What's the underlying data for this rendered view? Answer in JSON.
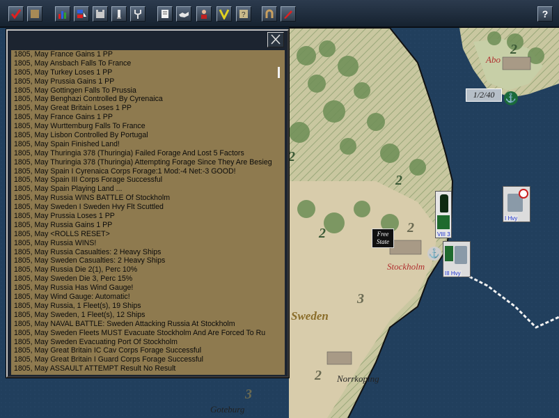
{
  "toolbar": {
    "buttons": [
      {
        "name": "checkmark-tool-button",
        "icon": "red-checkmark-icon"
      },
      {
        "name": "blank-tool-button",
        "icon": "tan-square-icon"
      },
      {
        "name": "bar-chart-button",
        "icon": "bar-chart-icon"
      },
      {
        "name": "unit-list-button",
        "icon": "flag-list-icon"
      },
      {
        "name": "fortress-button",
        "icon": "fortress-icon"
      },
      {
        "name": "lighthouse-button",
        "icon": "tower-icon"
      },
      {
        "name": "fork-button",
        "icon": "fork-icon"
      },
      {
        "name": "document-button",
        "icon": "document-icon"
      },
      {
        "name": "handshake-button",
        "icon": "handshake-icon"
      },
      {
        "name": "leader-button",
        "icon": "leader-portrait-icon"
      },
      {
        "name": "victory-button",
        "icon": "victory-v-icon"
      },
      {
        "name": "question-scroll-button",
        "icon": "question-scroll-icon"
      },
      {
        "name": "horseshoe-button",
        "icon": "horseshoe-icon"
      },
      {
        "name": "pen-button",
        "icon": "red-pen-icon"
      }
    ],
    "help_label": "?"
  },
  "log": {
    "close_label": "✕",
    "selected_index": 37,
    "entries": [
      "1805, May France Gains 1 PP",
      "1805, May Ansbach Falls To France",
      "1805, May Turkey Loses 1 PP",
      "1805, May Prussia Gains 1 PP",
      "1805, May Gottingen Falls To Prussia",
      "1805, May Benghazi Controlled By Cyrenaica",
      "1805, May Great Britain Loses 1 PP",
      "1805, May France Gains 1 PP",
      "1805, May Wurttemburg Falls To France",
      "1805, May Lisbon Controlled By Portugal",
      "1805, May Spain Finished Land!",
      "1805, May Thuringia 378 (Thuringia) Failed Forage And Lost 5 Factors",
      "1805, May Thuringia 378 (Thuringia) Attempting Forage Since They Are Besieg",
      "1805, May Spain I Cyrenaica Corps Forage:1 Mod:-4 Net:-3 GOOD!",
      "1805, May Spain III Corps Forage Successful",
      "1805, May Spain Playing Land ...",
      "1805, May Russia WINS BATTLE Of Stockholm",
      "1805, May Sweden I Sweden Hvy Flt Scuttled",
      "1805, May Prussia Loses 1 PP",
      "1805, May Russia Gains 1 PP",
      "1805, May <ROLLS RESET>",
      "1805, May Russia WINS!",
      "1805, May Russia Casualties: 2 Heavy Ships",
      "1805, May Sweden Casualties: 2 Heavy Ships",
      "1805, May Russia Die 2(1), Perc 10%",
      "1805, May Sweden Die 3, Perc 15%",
      "1805, May Russia Has Wind Gauge!",
      "1805, May Wind Gauge: Automatic!",
      "1805, May Russia, 1 Fleet(s), 19 Ships",
      "1805, May Sweden, 1 Fleet(s), 12 Ships",
      "1805, May NAVAL BATTLE: Sweden Attacking Russia At Stockholm",
      "1805, May Sweden Fleets MUST Evacuate Stockholm And Are Forced To Ru",
      "1805, May Sweden Evacuating Port Of Stockholm",
      "1805, May Great Britain IC Cav Corps Forage Successful",
      "1805, May Great Britain I Guard Corps Forage Successful",
      "1805, May ASSAULT ATTEMPT Result No Result"
    ]
  },
  "map": {
    "cities": {
      "abo": "Abo",
      "stockholm": "Stockholm",
      "norrkoping": "Norrkoping",
      "goteburg": "Goteburg"
    },
    "region_label": "Sweden",
    "sea_zone_badge": "1/2/40",
    "numbers": {
      "n1": "2",
      "n2": "2",
      "n3": "2",
      "n4": "2",
      "n5": "3",
      "n6": "2",
      "n7": "3",
      "n8": "2"
    },
    "free_state_label": "Free State",
    "units": {
      "infantry_label": "VIII 3",
      "fleet_near_label": "III Hvy",
      "fleet_far_label": "I Hvy"
    },
    "colors": {
      "sea": "#1f3f5e",
      "land": "#d8ccab",
      "forest": "#6f8f55",
      "selection": "#1b5fcc",
      "log_background": "#8e7a4f"
    }
  }
}
